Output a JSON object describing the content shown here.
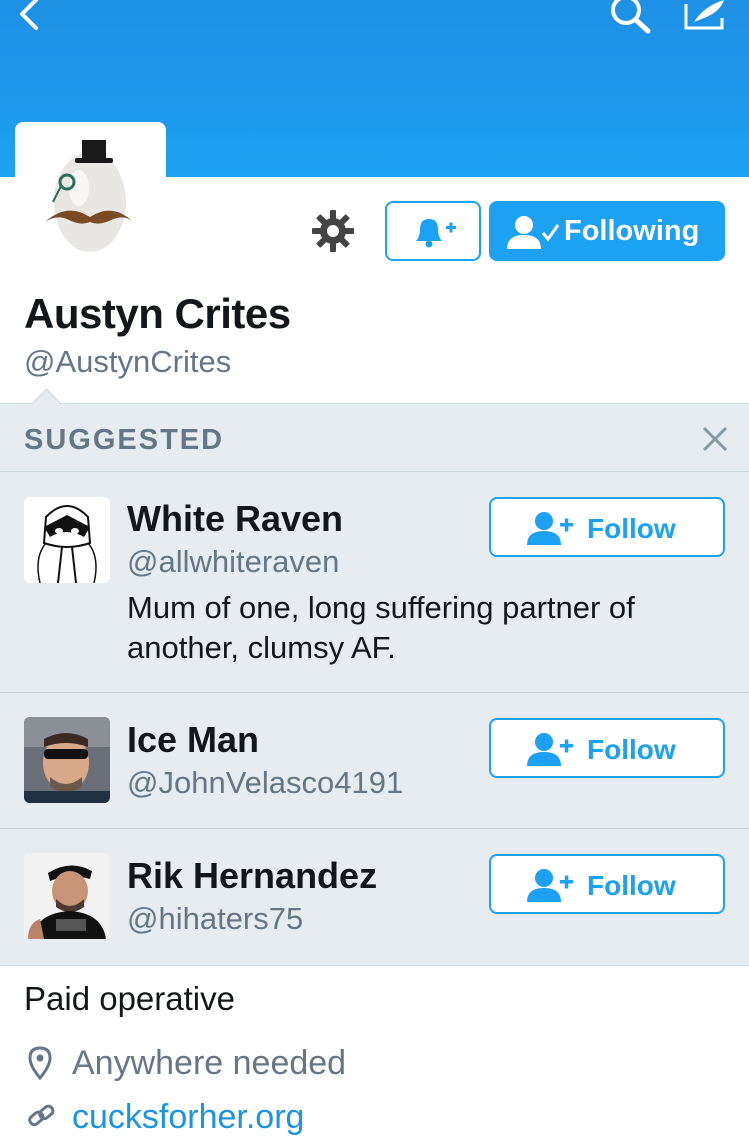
{
  "colors": {
    "brand_blue": "#1da1f2",
    "secondary_text": "#657786",
    "panel_bg": "#e6ecf0"
  },
  "profile": {
    "name": "Austyn Crites",
    "handle": "@AustynCrites",
    "following_label": "Following",
    "bio": "Paid operative",
    "location": "Anywhere needed",
    "website": "cucksforher.org"
  },
  "suggested": {
    "title": "SUGGESTED",
    "follow_label": "Follow",
    "users": [
      {
        "name": "White Raven",
        "handle": "@allwhiteraven",
        "bio": "Mum of one, long suffering partner of another, clumsy AF."
      },
      {
        "name": "Ice Man",
        "handle": "@JohnVelasco4191"
      },
      {
        "name": "Rik Hernandez",
        "handle": "@hihaters75"
      }
    ]
  },
  "icons": [
    "back-icon",
    "search-icon",
    "compose-icon",
    "gear-icon",
    "bell-plus-icon",
    "user-check-icon",
    "close-icon",
    "user-plus-icon",
    "location-pin-icon",
    "link-icon"
  ]
}
